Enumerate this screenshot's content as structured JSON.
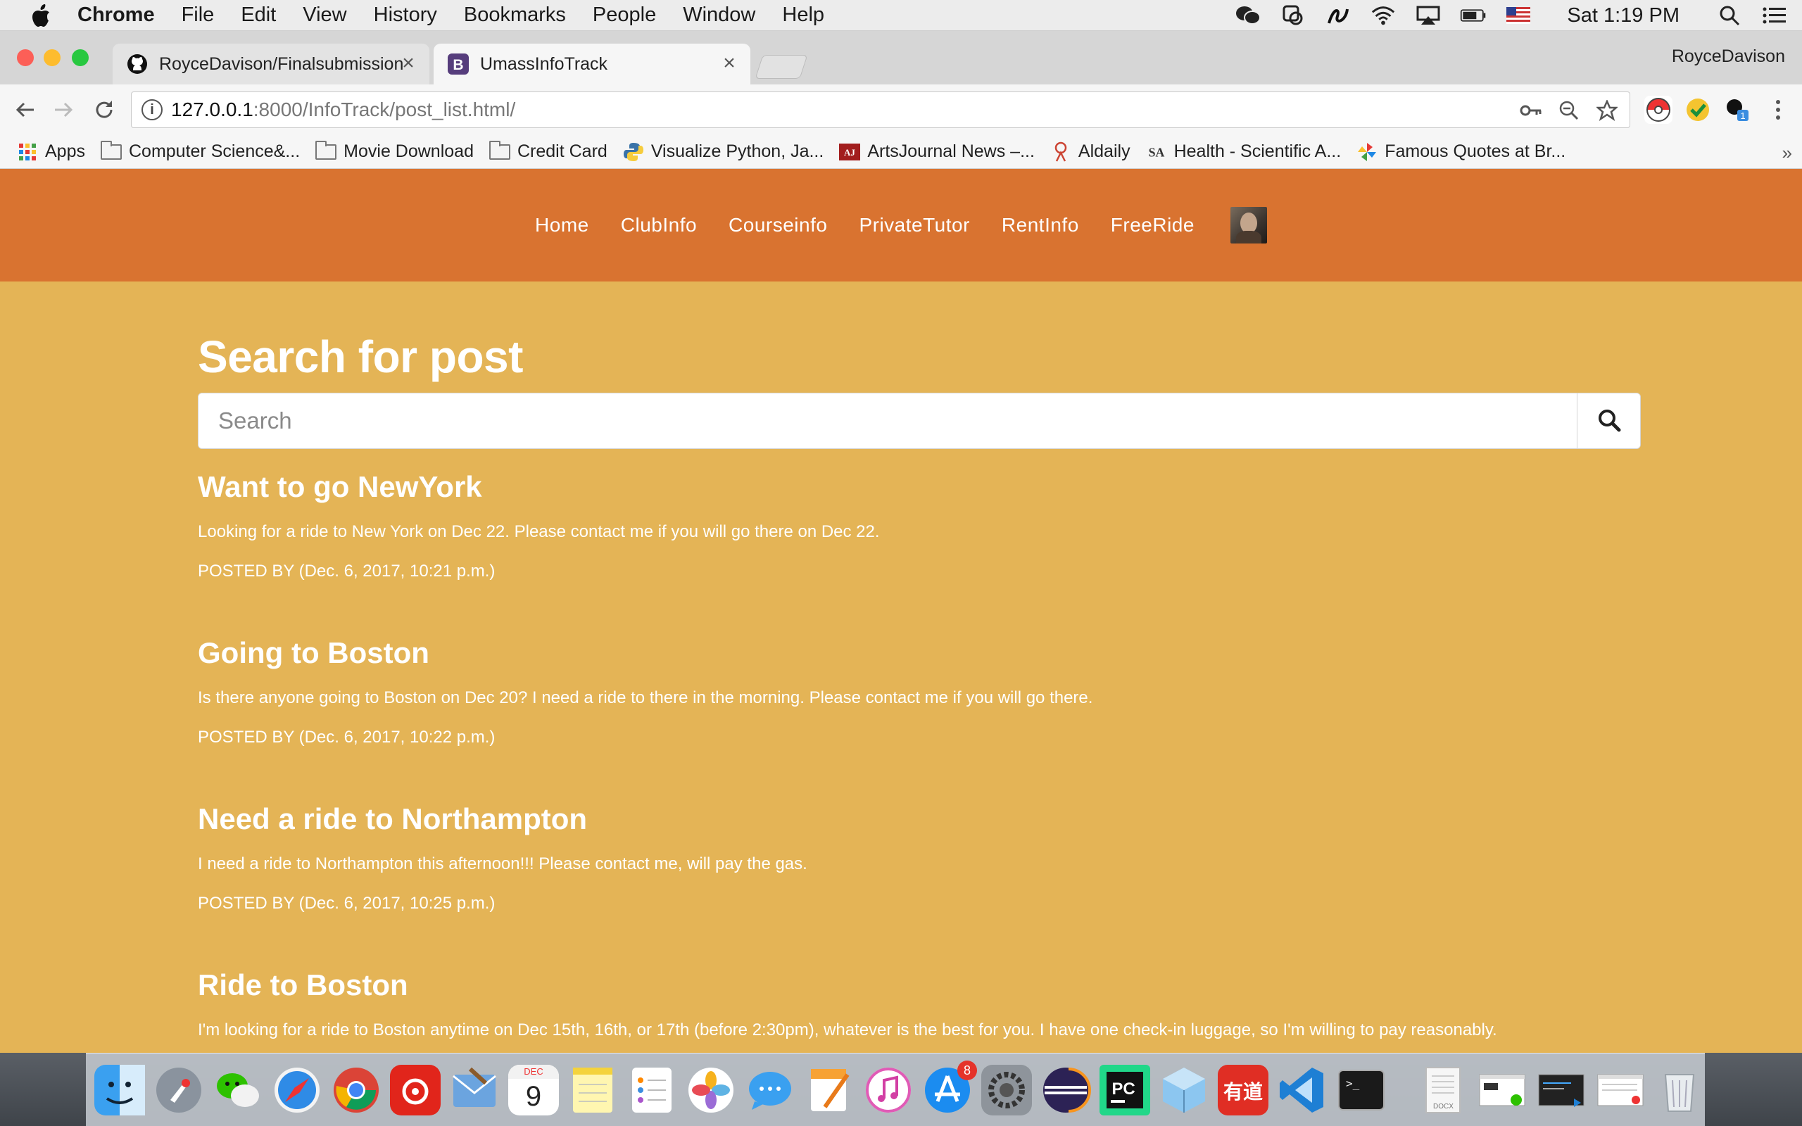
{
  "menubar": {
    "app_name": "Chrome",
    "menus": [
      "File",
      "Edit",
      "View",
      "History",
      "Bookmarks",
      "People",
      "Window",
      "Help"
    ],
    "clock": "Sat 1:19 PM",
    "status_icons": [
      "wechat-icon",
      "qq-icon",
      "script-icon",
      "wifi-icon",
      "airplay-icon",
      "battery-icon",
      "us-flag-icon",
      "spotlight-search-icon",
      "notification-center-icon"
    ]
  },
  "browser": {
    "tabs": [
      {
        "title": "RoyceDavison/Finalsubmission",
        "icon": "github-icon",
        "active": false
      },
      {
        "title": "UmassInfoTrack",
        "icon": "bootstrap-icon",
        "active": true
      }
    ],
    "profile_name": "RoyceDavison",
    "url_host": "127.0.0.1",
    "url_rest": ":8000/InfoTrack/post_list.html/",
    "bookmarks": [
      {
        "label": "Apps",
        "icon": "apps-grid-icon"
      },
      {
        "label": "Computer Science&...",
        "icon": "folder-icon"
      },
      {
        "label": "Movie Download",
        "icon": "folder-icon"
      },
      {
        "label": "Credit Card",
        "icon": "folder-icon"
      },
      {
        "label": "Visualize Python, Ja...",
        "icon": "python-icon"
      },
      {
        "label": "ArtsJournal News –...",
        "icon": "artsjournal-icon"
      },
      {
        "label": "Aldaily",
        "icon": "aldaily-icon"
      },
      {
        "label": "Health - Scientific A...",
        "icon": "sa-icon"
      },
      {
        "label": "Famous Quotes at Br...",
        "icon": "pinwheel-icon"
      }
    ],
    "bookmarks_overflow": "»"
  },
  "site": {
    "nav": [
      "Home",
      "ClubInfo",
      "Courseinfo",
      "PrivateTutor",
      "RentInfo",
      "FreeRide"
    ],
    "page_title": "Search for post",
    "search_placeholder": "Search",
    "posts": [
      {
        "title": "Want to go NewYork",
        "body": "Looking for a ride to New York on Dec 22. Please contact me if you will go there on Dec 22.",
        "meta": "POSTED BY (Dec. 6, 2017, 10:21 p.m.)"
      },
      {
        "title": "Going to Boston",
        "body": "Is there anyone going to Boston on Dec 20? I need a ride to there in the morning. Please contact me if you will go there.",
        "meta": "POSTED BY (Dec. 6, 2017, 10:22 p.m.)"
      },
      {
        "title": "Need a ride to Northampton",
        "body": "I need a ride to Northampton this afternoon!!! Please contact me, will pay the gas.",
        "meta": "POSTED BY (Dec. 6, 2017, 10:25 p.m.)"
      },
      {
        "title": "Ride to Boston",
        "body": "I'm looking for a ride to Boston anytime on Dec 15th, 16th, or 17th (before 2:30pm), whatever is the best for you. I have one check-in luggage, so I'm willing to pay reasonably.",
        "meta": ""
      }
    ]
  },
  "dock": {
    "apps": [
      "finder-icon",
      "launchpad-icon",
      "wechat-icon",
      "safari-icon",
      "chrome-icon",
      "netease-music-icon",
      "mail-icon",
      "calendar-icon",
      "notes-icon",
      "reminders-icon",
      "photos-icon",
      "messages-icon",
      "pages-icon",
      "itunes-icon",
      "app-store-icon",
      "system-preferences-icon",
      "eclipse-icon",
      "pycharm-icon",
      "virtualbox-icon",
      "youdao-icon",
      "vscode-icon",
      "terminal-icon"
    ],
    "app_store_badge": "8",
    "calendar_month": "DEC",
    "calendar_day": "9",
    "documents_label": "DOCX"
  }
}
